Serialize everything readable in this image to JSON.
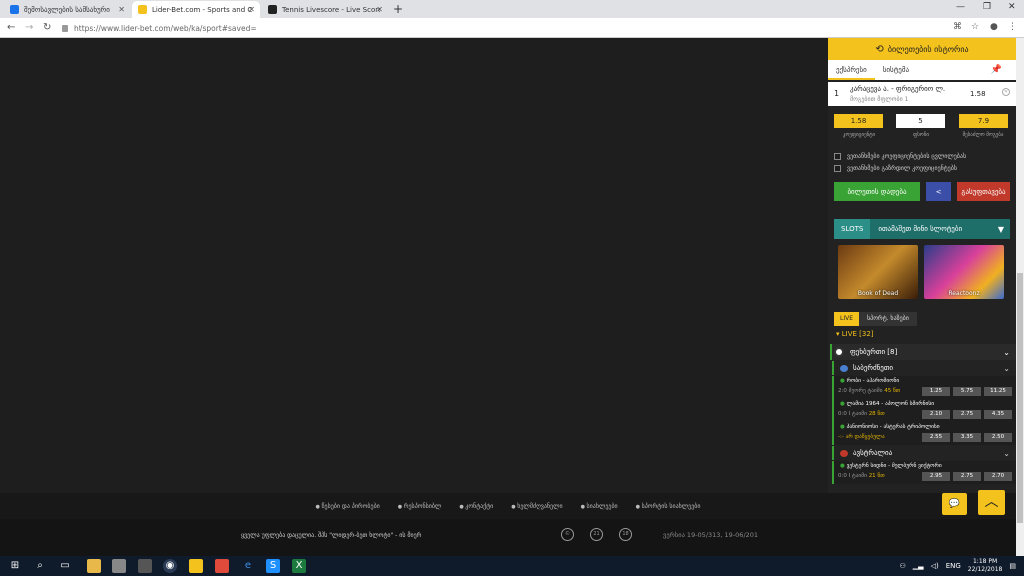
{
  "browser": {
    "tabs": [
      {
        "title": "შემოსავლების სამსახური",
        "active": false,
        "color": "#1a73e8"
      },
      {
        "title": "Lider-Bet.com - Sports and Casino",
        "active": true,
        "color": "#f4c21c"
      },
      {
        "title": "Tennis Livescore - Live Scores &",
        "active": false,
        "color": "#222222"
      }
    ],
    "url": "https://www.lider-bet.com/web/ka/sport#saved="
  },
  "betslip": {
    "history_button": "ბილეთების ისტორია",
    "tabs": [
      "ექსპრესი",
      "სისტემა"
    ],
    "bet": {
      "index": "1",
      "match": "კარაცევა ა. - ფრიგერიო ლ.",
      "market": "მოგებით მფლობი",
      "pick": "1",
      "odd": "1.58"
    },
    "coefficient": "1.58",
    "coefficient_label": "კოეფიციენტი",
    "stake": "5",
    "stake_label": "ფსონი",
    "payout": "7.9",
    "payout_label": "შესაძლო მოგება",
    "checkbox1": "ვეთანხმები კოეფიციენტების ცვლილებას",
    "checkbox2": "ვეთანხმები გაზრდილ კოეფიციენტებს",
    "place_button": "ბილეთის დადება",
    "share_icon": "share-icon",
    "clear_button": "გასუფთავება"
  },
  "slots": {
    "tab": "SLOTS",
    "title": "ითამაშეთ მინი სლოტები",
    "games": [
      {
        "name": "Book of Dead"
      },
      {
        "name": "Reactoonz"
      }
    ]
  },
  "live": {
    "tab_live": "LIVE",
    "tab_prematch": "სპორტ. ხაზები",
    "count": "LIVE [32]",
    "sport": "ფეხბურთი [8]",
    "countries": [
      {
        "name": "საბერძნეთი",
        "events": [
          {
            "name": "რობი - აჰარომიონი",
            "status": "2:0 მეორე ტაიმი",
            "minute": "45 წთ",
            "odds": [
              "1.25",
              "5.75",
              "11.25"
            ]
          },
          {
            "name": "ლამია 1964 - აპოლონ სმირნისი",
            "status": "0:0 I ტაიმი",
            "minute": "28 წთ",
            "odds": [
              "2.10",
              "2.75",
              "4.35"
            ]
          },
          {
            "name": "პანიონიოსი - ასტერას ტრიპოლისი",
            "status": "-:- არ დაწყებულა",
            "minute": "",
            "odds": [
              "2.55",
              "3.35",
              "2.50"
            ]
          }
        ]
      },
      {
        "name": "ავსტრალია",
        "events": [
          {
            "name": "ვესტერნ სიდნი - მელბურნ ვიქტორი",
            "status": "0:0 I ტაიმი",
            "minute": "21 წთ",
            "odds": [
              "2.95",
              "2.75",
              "2.70"
            ]
          }
        ]
      }
    ]
  },
  "footer": {
    "links": [
      "წესები და პირობები",
      "რესპონსიბლ",
      "კონტაქტი",
      "ხელმძღვანელი",
      "სიახლეები",
      "სპორტის სიახლეები"
    ],
    "note": "ყველა უფლება დაცულია. შპს \"ლიდერ-ბეთ ხლოტი\" - ის მიერ",
    "circles": [
      "©",
      "21",
      "18"
    ],
    "version": "ვერსია 19-05/313, 19-06/201"
  },
  "taskbar": {
    "lang": "ENG",
    "time": "1:18 PM",
    "date": "22/12/2018"
  }
}
